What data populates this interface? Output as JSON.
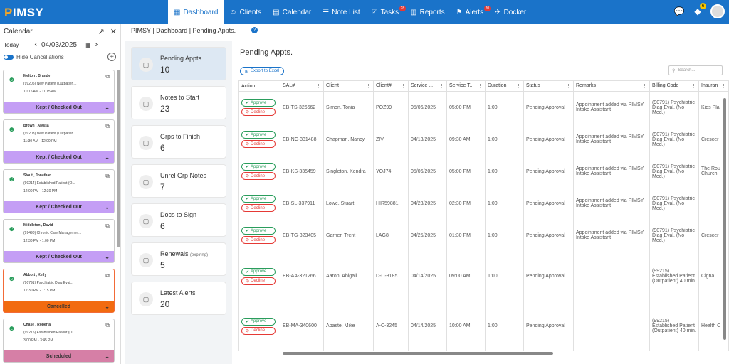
{
  "app": {
    "logo": "PIMSY",
    "logo_accent": "P"
  },
  "nav": [
    {
      "label": "Dashboard",
      "icon": "grid-icon",
      "active": true
    },
    {
      "label": "Clients",
      "icon": "person-icon"
    },
    {
      "label": "Calendar",
      "icon": "calendar-icon"
    },
    {
      "label": "Note List",
      "icon": "list-icon"
    },
    {
      "label": "Tasks",
      "icon": "tasks-icon",
      "badge": "28"
    },
    {
      "label": "Reports",
      "icon": "reports-icon"
    },
    {
      "label": "Alerts",
      "icon": "alert-icon",
      "badge": "20"
    },
    {
      "label": "Docker",
      "icon": "docker-icon"
    }
  ],
  "top_right": {
    "notif_badge": "6"
  },
  "calendar": {
    "title": "Calendar",
    "today": "Today",
    "date": "04/03/2025",
    "hide_label": "Hide Cancellations",
    "appointments": [
      {
        "name": "Melton , Brandy",
        "desc": "(99205) New Patient (Outpatien...",
        "time": "10:15 AM - 11:15 AM",
        "status": "Kept / Checked Out",
        "kind": "kept"
      },
      {
        "name": "Brown , Alyssa",
        "desc": "(99203) New Patient (Outpatien...",
        "time": "11:30 AM - 12:00 PM",
        "status": "Kept / Checked Out",
        "kind": "kept"
      },
      {
        "name": "Stout , Jonathan",
        "desc": "(99214) Established Patient (O...",
        "time": "12:00 PM - 12:30 PM",
        "status": "Kept / Checked Out",
        "kind": "kept"
      },
      {
        "name": "Middleton , David",
        "desc": "(99490) Chronic Care Managemen...",
        "time": "12:30 PM - 1:00 PM",
        "status": "Kept / Checked Out",
        "kind": "kept"
      },
      {
        "name": "Abbott , Kelly",
        "desc": "(90791) Psychiatric Diag Eval...",
        "time": "12:30 PM - 1:15 PM",
        "status": "Cancelled",
        "kind": "cancel"
      },
      {
        "name": "Chase , Roberta",
        "desc": "(99215) Established Patient (O...",
        "time": "3:00 PM - 3:45 PM",
        "status": "Scheduled",
        "kind": "sched"
      }
    ]
  },
  "breadcrumb": "PIMSY | Dashboard | Pending Appts.",
  "cards": [
    {
      "label": "Pending Appts.",
      "value": "10",
      "active": true
    },
    {
      "label": "Notes to Start",
      "value": "23"
    },
    {
      "label": "Grps to Finish",
      "value": "6"
    },
    {
      "label": "Unrel Grp Notes",
      "value": "7"
    },
    {
      "label": "Docs to Sign",
      "value": "6"
    },
    {
      "label": "Renewals",
      "sub": "(expiring)",
      "value": "5"
    },
    {
      "label": "Latest Alerts",
      "value": "20"
    }
  ],
  "main": {
    "title": "Pending Appts.",
    "export_label": "Export to Excel",
    "search_placeholder": "Search...",
    "approve_label": "Approve",
    "decline_label": "Decline",
    "columns": [
      "Action",
      "SAL#",
      "Client",
      "Client#",
      "Service ...",
      "Service T...",
      "Duration",
      "Status",
      "Remarks",
      "Billing Code",
      "Insuran"
    ],
    "rows": [
      {
        "sal": "EB-TS-326662",
        "client": "Simon, Tonia",
        "cnum": "POZ99",
        "date": "05/06/2025",
        "time": "05:00 PM",
        "dur": "1:00",
        "status": "Pending Approval",
        "remarks": "Appointment added via PIMSY Intake Assistant",
        "billing": "(90791) Psychiatric Diag Eval. (No Med.)",
        "ins": "Kids Pla",
        "tall": false
      },
      {
        "sal": "EB-NC-331488",
        "client": "Chapman, Nancy",
        "cnum": "ZIV",
        "date": "04/13/2025",
        "time": "09:30 AM",
        "dur": "1:00",
        "status": "Pending Approval",
        "remarks": "Appointment added via PIMSY Intake Assistant",
        "billing": "(90791) Psychiatric Diag Eval. (No Med.)",
        "ins": "Crescer",
        "tall": false
      },
      {
        "sal": "EB-KS-335459",
        "client": "Singleton, Kendra",
        "cnum": "YOJ74",
        "date": "05/06/2025",
        "time": "05:00 PM",
        "dur": "1:00",
        "status": "Pending Approval",
        "remarks": "Appointment added via PIMSY Intake Assistant",
        "billing": "(90791) Psychiatric Diag Eval. (No Med.)",
        "ins": "The Rou Church",
        "tall": false
      },
      {
        "sal": "EB-SL-337911",
        "client": "Lowe, Stuart",
        "cnum": "HIR59881",
        "date": "04/23/2025",
        "time": "02:30 PM",
        "dur": "1:00",
        "status": "Pending Approval",
        "remarks": "Appointment added via PIMSY Intake Assistant",
        "billing": "(90791) Psychiatric Diag Eval. (No Med.)",
        "ins": "",
        "tall": false
      },
      {
        "sal": "EB-TG-323405",
        "client": "Garner, Trent",
        "cnum": "LAG8",
        "date": "04/25/2025",
        "time": "01:30 PM",
        "dur": "1:00",
        "status": "Pending Approval",
        "remarks": "Appointment added via PIMSY Intake Assistant",
        "billing": "(90791) Psychiatric Diag Eval. (No Med.)",
        "ins": "Crescer",
        "tall": false
      },
      {
        "sal": "EB-AA-321266",
        "client": "Aaron, Abigail",
        "cnum": "D-C-3185",
        "date": "04/14/2025",
        "time": "09:00 AM",
        "dur": "1:00",
        "status": "Pending Approval",
        "remarks": "",
        "billing": "(99215) Established Patient (Outpatient) 40 min.",
        "ins": "Cigna",
        "tall": true
      },
      {
        "sal": "EB-MA-340600",
        "client": "Abaste, Mike",
        "cnum": "A-C-3245",
        "date": "04/14/2025",
        "time": "10:00 AM",
        "dur": "1:00",
        "status": "Pending Approval",
        "remarks": "",
        "billing": "(99215) Established Patient (Outpatient) 40 min.",
        "ins": "Health C",
        "tall": true
      }
    ]
  }
}
